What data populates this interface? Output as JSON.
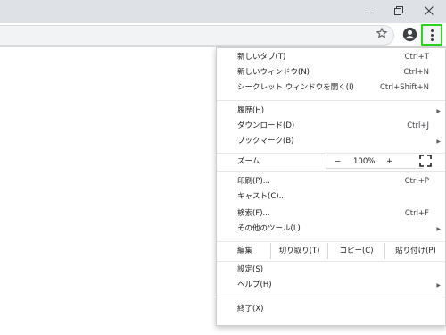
{
  "window": {
    "minimize_icon": "minimize-icon",
    "restore_icon": "restore-icon",
    "close_icon": "close-icon"
  },
  "toolbar": {
    "bookmark_icon": "star-icon",
    "profile_icon": "account-icon",
    "menu_icon": "more-vertical-icon",
    "highlight_color": "#27d618"
  },
  "menu": {
    "new_tab": {
      "label": "新しいタブ(T)",
      "shortcut": "Ctrl+T"
    },
    "new_window": {
      "label": "新しいウィンドウ(N)",
      "shortcut": "Ctrl+N"
    },
    "incognito": {
      "label": "シークレット ウィンドウを開く(I)",
      "shortcut": "Ctrl+Shift+N"
    },
    "history": {
      "label": "履歴(H)"
    },
    "downloads": {
      "label": "ダウンロード(D)",
      "shortcut": "Ctrl+J"
    },
    "bookmarks": {
      "label": "ブックマーク(B)"
    },
    "zoom": {
      "label": "ズーム",
      "minus": "−",
      "value": "100%",
      "plus": "+"
    },
    "print": {
      "label": "印刷(P)...",
      "shortcut": "Ctrl+P"
    },
    "cast": {
      "label": "キャスト(C)..."
    },
    "find": {
      "label": "検索(F)...",
      "shortcut": "Ctrl+F"
    },
    "more_tools": {
      "label": "その他のツール(L)"
    },
    "edit": {
      "label": "編集",
      "cut": "切り取り(T)",
      "copy": "コピー(C)",
      "paste": "貼り付け(P)"
    },
    "settings": {
      "label": "設定(S)"
    },
    "help": {
      "label": "ヘルプ(H)"
    },
    "exit": {
      "label": "終了(X)"
    }
  }
}
